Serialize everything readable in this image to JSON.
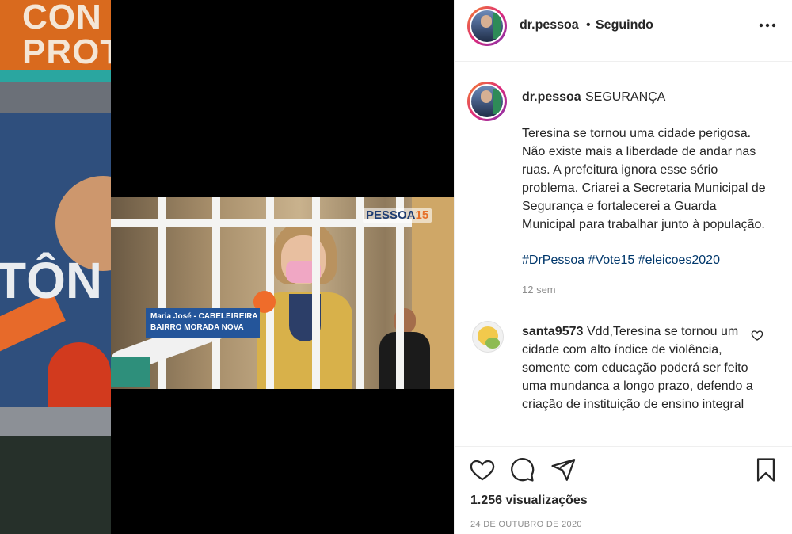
{
  "background": {
    "text_top": "CON\nPROT",
    "text_mid": "TÔN"
  },
  "video": {
    "logo_brand": "PESSOA",
    "logo_number": "15",
    "caption_name": "Maria José - CABELEIREIRA",
    "caption_place": "BAIRRO MORADA NOVA"
  },
  "header": {
    "username": "dr.pessoa",
    "separator": "•",
    "follow_status": "Seguindo",
    "more_icon": "more-options-icon"
  },
  "post": {
    "username": "dr.pessoa",
    "title": "SEGURANÇA",
    "text": "Teresina se tornou uma cidade perigosa. Não existe mais a liberdade de andar nas ruas. A prefeitura ignora esse sério problema. Criarei a Secretaria Municipal de Segurança e fortalecerei a Guarda Municipal para trabalhar junto à população.",
    "hashtags": "#DrPessoa #Vote15 #eleicoes2020",
    "time": "12 sem"
  },
  "comments": [
    {
      "username": "santa9573",
      "text": "Vdd,Teresina se tornou um cidade com alto índice de violência, somente com educação poderá ser feito uma mundanca a longo prazo, defendo a criação de instituição de ensino integral"
    }
  ],
  "actions": {
    "views": "1.256 visualizações",
    "date": "24 DE OUTUBRO DE 2020"
  },
  "colors": {
    "text": "#262626",
    "muted": "#8e8e8e",
    "hashtag": "#00376b",
    "border": "#efefef"
  }
}
